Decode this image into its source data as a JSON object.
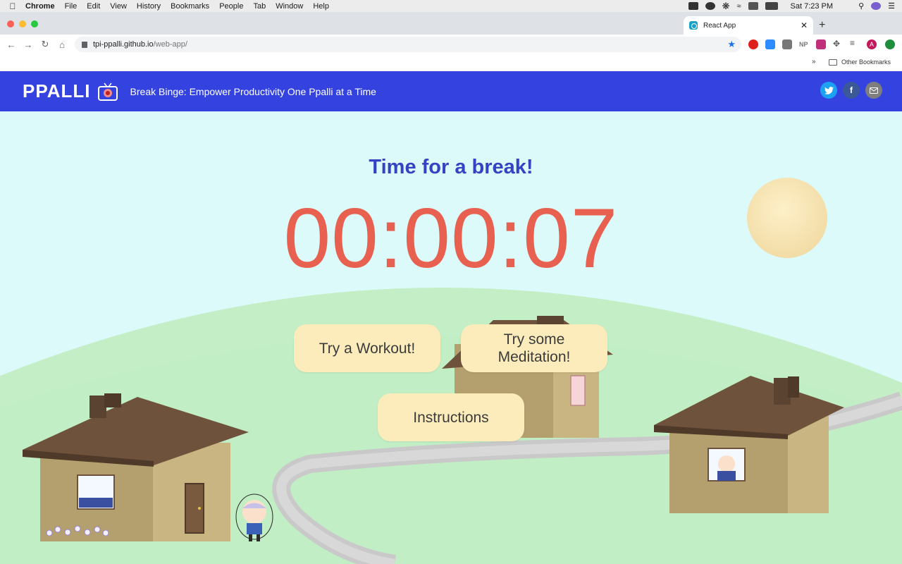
{
  "menubar": {
    "app": "Chrome",
    "items": [
      "File",
      "Edit",
      "View",
      "History",
      "Bookmarks",
      "People",
      "Tab",
      "Window",
      "Help"
    ],
    "clock": "Sat 7:23 PM"
  },
  "browser": {
    "tab_title": "React App",
    "url_host": "tpi-ppalli.github.io",
    "url_path": "/web-app/",
    "other_bookmarks": "Other Bookmarks",
    "bookmarks_overflow": "»",
    "extension_label_np": "NP",
    "profile_initial": "A"
  },
  "header": {
    "logo": "PPALLI",
    "tagline": "Break Binge: Empower Productivity One Ppalli at a Time",
    "social": {
      "twitter_icon": "twitter-icon",
      "facebook_icon": "facebook-icon",
      "email_icon": "mail-icon",
      "facebook_glyph": "f"
    }
  },
  "main": {
    "title": "Time for a break!",
    "timer": "00:00:07",
    "workout_button": "Try a Workout!",
    "meditation_button_line1": "Try some",
    "meditation_button_line2": "Meditation!",
    "instructions_button": "Instructions"
  },
  "colors": {
    "header_bg": "#3442e0",
    "sky": "#dcfafa",
    "title": "#3442c4",
    "timer": "#e8604f",
    "button_bg": "#fcecbc",
    "grass": "#c4eec6",
    "house_wall": "#b49f6e",
    "roof": "#6f523c"
  }
}
